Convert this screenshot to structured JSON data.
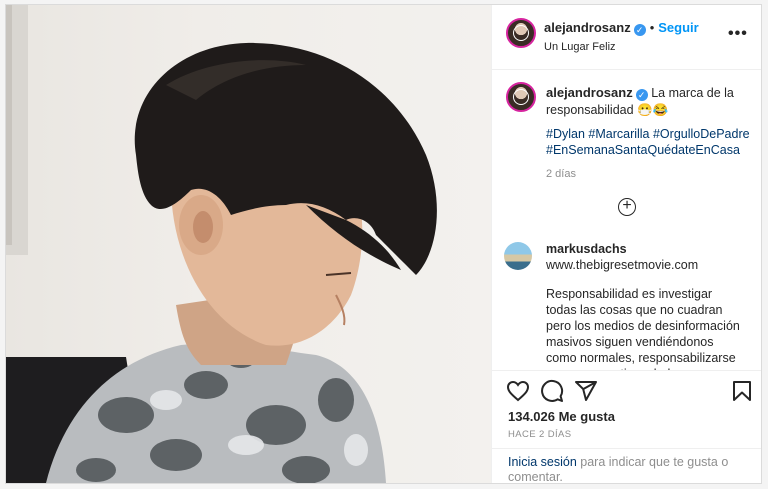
{
  "header": {
    "username": "alejandrosanz",
    "verified_icon": "verified-badge-icon",
    "separator": "•",
    "follow_label": "Seguir",
    "location": "Un Lugar Feliz",
    "more_label": "•••"
  },
  "caption": {
    "username": "alejandrosanz",
    "text": "La marca de la responsabilidad 😷😂",
    "hashtags": "#Dylan #Marcarilla #OrgulloDePadre #EnSemanaSantaQuédateEnCasa",
    "time": "2 días"
  },
  "load_more": {
    "icon": "plus-circle-icon",
    "label": "+"
  },
  "comment": {
    "username": "markusdachs",
    "link": "www.thebigresetmovie.com",
    "text": "Responsabilidad es investigar todas las cosas que no cuadran pero los medios de desinformación masivos siguen vendiéndonos como normales, responsabilizarse es no consentir...salud en manos de un"
  },
  "actions": {
    "icons": [
      "heart-icon",
      "comment-icon",
      "share-icon",
      "bookmark-icon"
    ],
    "likes": "134.026 Me gusta",
    "posted_ago": "HACE 2 DÍAS"
  },
  "login_prompt": {
    "link": "Inicia sesión",
    "text": " para indicar que te gusta o comentar."
  },
  "colors": {
    "accent": "#0095f6",
    "verified": "#3897f0",
    "hashtag": "#00376b",
    "muted": "#8e8e8e"
  }
}
